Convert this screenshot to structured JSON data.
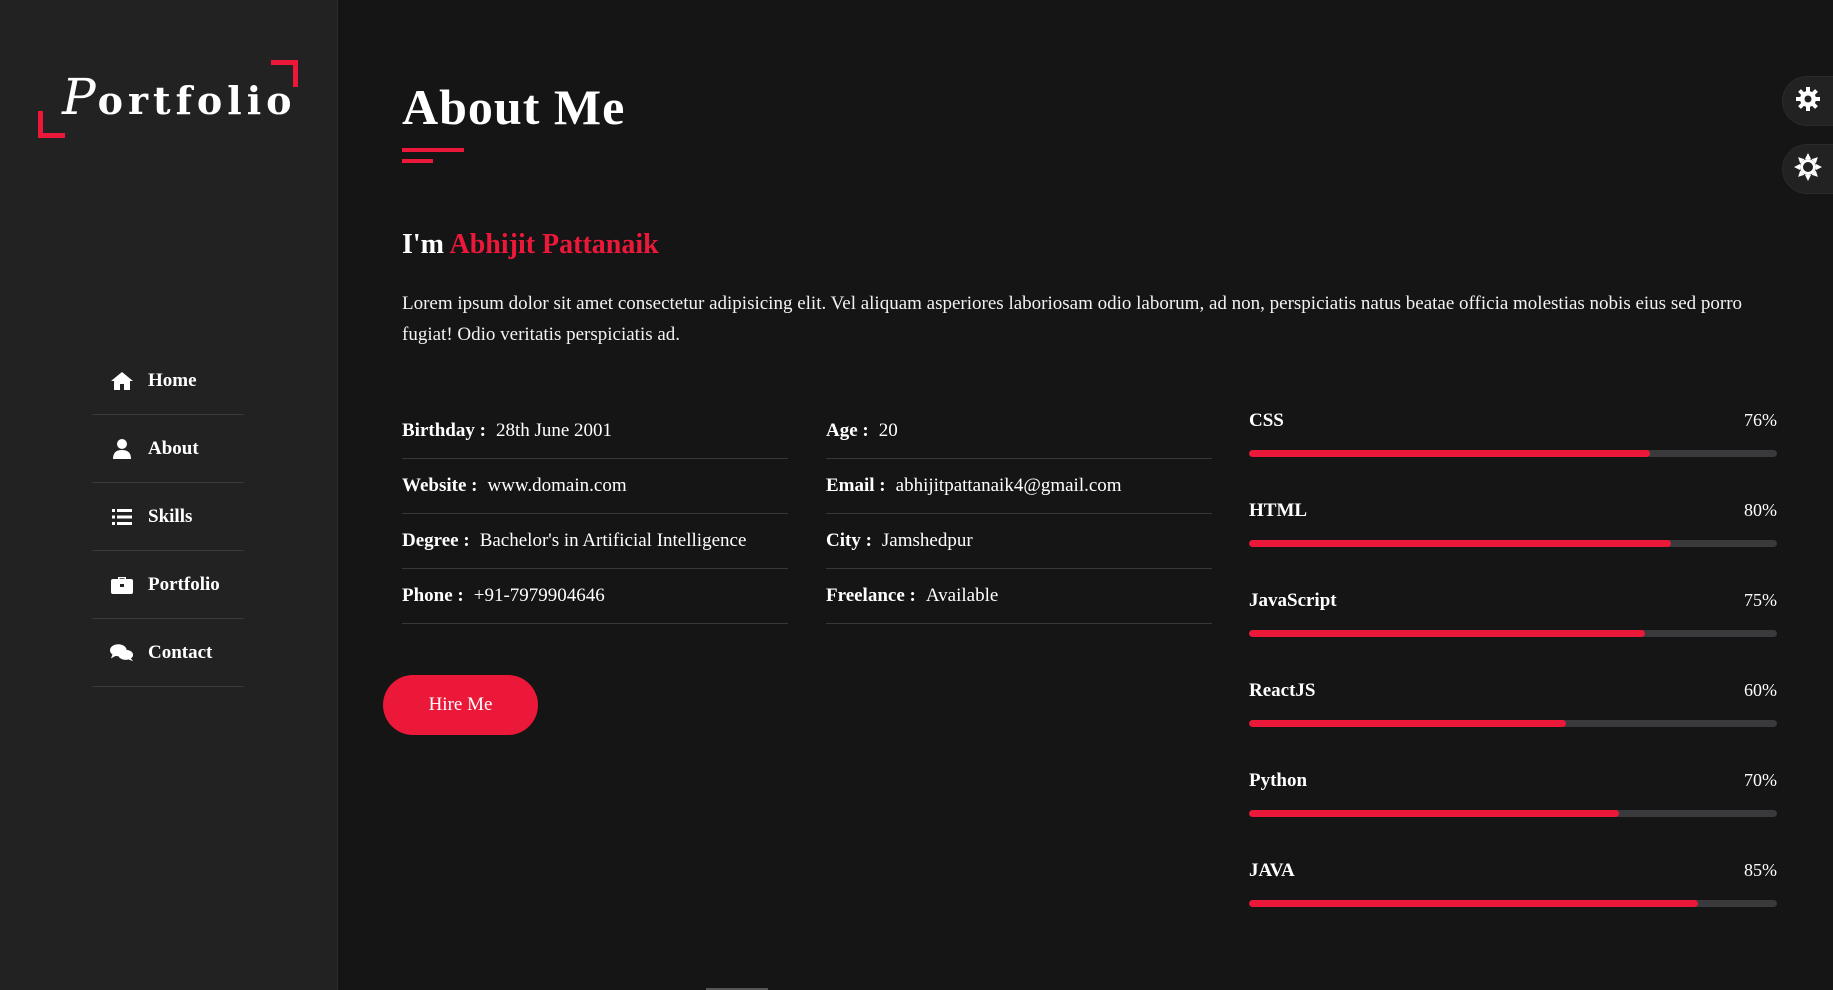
{
  "logo": {
    "cap": "P",
    "rest": "ortfolio"
  },
  "nav": [
    {
      "label": "Home",
      "icon": "home-icon"
    },
    {
      "label": "About",
      "icon": "user-icon"
    },
    {
      "label": "Skills",
      "icon": "list-icon"
    },
    {
      "label": "Portfolio",
      "icon": "briefcase-icon"
    },
    {
      "label": "Contact",
      "icon": "comments-icon"
    }
  ],
  "section": {
    "title": "About Me"
  },
  "intro": {
    "prefix": "I'm ",
    "name": "Abhijit Pattanaik"
  },
  "description": "Lorem ipsum dolor sit amet consectetur adipisicing elit. Vel aliquam asperiores laboriosam odio laborum, ad non, perspiciatis natus beatae officia molestias nobis eius sed porro fugiat! Odio veritatis perspiciatis ad.",
  "info_left": [
    {
      "label": "Birthday :",
      "value": "28th June 2001"
    },
    {
      "label": "Website :",
      "value": "www.domain.com"
    },
    {
      "label": "Degree :",
      "value": "Bachelor's in Artificial Intelligence"
    },
    {
      "label": "Phone :",
      "value": "+91-7979904646"
    }
  ],
  "info_right": [
    {
      "label": "Age :",
      "value": "20"
    },
    {
      "label": "Email :",
      "value": "abhijitpattanaik4@gmail.com"
    },
    {
      "label": "City :",
      "value": "Jamshedpur"
    },
    {
      "label": "Freelance :",
      "value": "Available"
    }
  ],
  "hire_label": "Hire Me",
  "skills": [
    {
      "name": "CSS",
      "percent": "76%",
      "value": 76
    },
    {
      "name": "HTML",
      "percent": "80%",
      "value": 80
    },
    {
      "name": "JavaScript",
      "percent": "75%",
      "value": 75
    },
    {
      "name": "ReactJS",
      "percent": "60%",
      "value": 60
    },
    {
      "name": "Python",
      "percent": "70%",
      "value": 70
    },
    {
      "name": "JAVA",
      "percent": "85%",
      "value": 85
    }
  ],
  "colors": {
    "accent": "#ec1839",
    "background": "#151516",
    "sidebar": "#222223"
  },
  "switchers": [
    {
      "icon": "gear-icon"
    },
    {
      "icon": "sun-icon"
    }
  ]
}
